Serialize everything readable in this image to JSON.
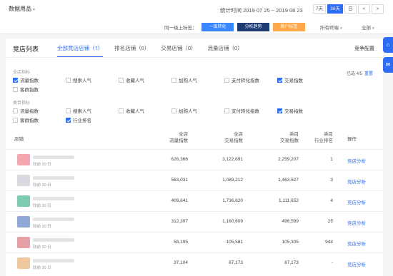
{
  "topbar": {
    "category": "数据用品",
    "period_prefix": "统计时间",
    "period_range": "2019 07 25 ~ 2019 08 23",
    "range_buttons": [
      "7天",
      "30天",
      "日",
      "<",
      ">"
    ],
    "range_active": "30天"
  },
  "compare": {
    "label": "同一级上标签：",
    "chips": [
      "一级转化",
      "分析趋势",
      "商户标签"
    ],
    "chip_colors": [
      "#3a86ff",
      "#1f3b73",
      "#ffa94d"
    ],
    "dropdown1": "所有终端",
    "dropdown2": "全部"
  },
  "panel": {
    "title": "竞店列表",
    "tabs": [
      "全部竞店店铺（7）",
      "排名店铺（0）",
      "交易店铺（0）",
      "流量店铺（0）"
    ],
    "config_label": "竞争配置",
    "group1_title": "全店指标",
    "group1_items": [
      {
        "label": "流量指数",
        "checked": true
      },
      {
        "label": "搜索人气",
        "checked": false
      },
      {
        "label": "收藏人气",
        "checked": false
      },
      {
        "label": "加购人气",
        "checked": false
      },
      {
        "label": "支付转化指数",
        "checked": false
      },
      {
        "label": "交易指数",
        "checked": true
      },
      {
        "label": "客群指数",
        "checked": false
      }
    ],
    "group2_title": "类目指标",
    "group2_items": [
      {
        "label": "流量指数",
        "checked": false
      },
      {
        "label": "搜索人气",
        "checked": false
      },
      {
        "label": "收藏人气",
        "checked": false
      },
      {
        "label": "加购人气",
        "checked": false
      },
      {
        "label": "支付转化指数",
        "checked": false
      },
      {
        "label": "交易指数",
        "checked": true
      },
      {
        "label": "客群指数",
        "checked": false
      },
      {
        "label": "行业排名",
        "checked": true
      }
    ],
    "selected_text": "已选 4/5",
    "reset_label": "重置"
  },
  "table": {
    "columns": [
      "店铺",
      "全店\n流量指数",
      "全店\n交易指数",
      "类目\n交易指数",
      "类目\n行业排名",
      "操作"
    ],
    "rows": [
      {
        "sub": "较前 30 日",
        "flow": "626,366",
        "trade": "3,122,691",
        "cat_trade": "2,259,207",
        "rank": "1",
        "action": "竞店分析",
        "thumb": "#f3a6ae"
      },
      {
        "sub": "较前 30 日",
        "flow": "563,031",
        "trade": "1,089,212",
        "cat_trade": "1,463,527",
        "rank": "3",
        "action": "竞店分析",
        "thumb": "#d9d9e0"
      },
      {
        "sub": "较前 30 日",
        "flow": "409,641",
        "trade": "1,736,620",
        "cat_trade": "1,111,652",
        "rank": "4",
        "action": "竞店分析",
        "thumb": "#7ecbb3"
      },
      {
        "sub": "较前 30 日",
        "flow": "312,307",
        "trade": "1,160,609",
        "cat_trade": "496,599",
        "rank": "25",
        "action": "竞店分析",
        "thumb": "#8fa8d6"
      },
      {
        "sub": "较前 30 日",
        "flow": "58,195",
        "trade": "105,581",
        "cat_trade": "105,305",
        "rank": "944",
        "action": "竞店分析",
        "thumb": "#e6a0a8"
      },
      {
        "sub": "较前 30 日",
        "flow": "37,104",
        "trade": "87,173",
        "cat_trade": "87,173",
        "rank": "-",
        "action": "竞店分析",
        "thumb": "#f0c8a0"
      }
    ]
  }
}
